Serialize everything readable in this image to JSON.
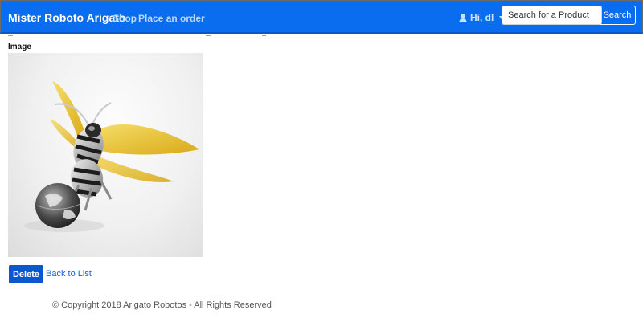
{
  "navbar": {
    "brand": "Mister Roboto Arigato",
    "links": [
      "Shop",
      "Place an order"
    ],
    "user_greeting": "Hi, dl",
    "user_icon": "user-icon",
    "search": {
      "placeholder": "Search for a Product",
      "value": "",
      "button_label": "Search"
    },
    "accent_color": "#0a6df0"
  },
  "details": {
    "field_label": "Image",
    "image_alt": "Robotic bee"
  },
  "actions": {
    "delete_label": "Delete",
    "back_label": "Back to List",
    "delete_color": "#0a57d0"
  },
  "footer": {
    "copyright": "© Copyright 2018 Arigato Robotos - All Rights Reserved"
  }
}
